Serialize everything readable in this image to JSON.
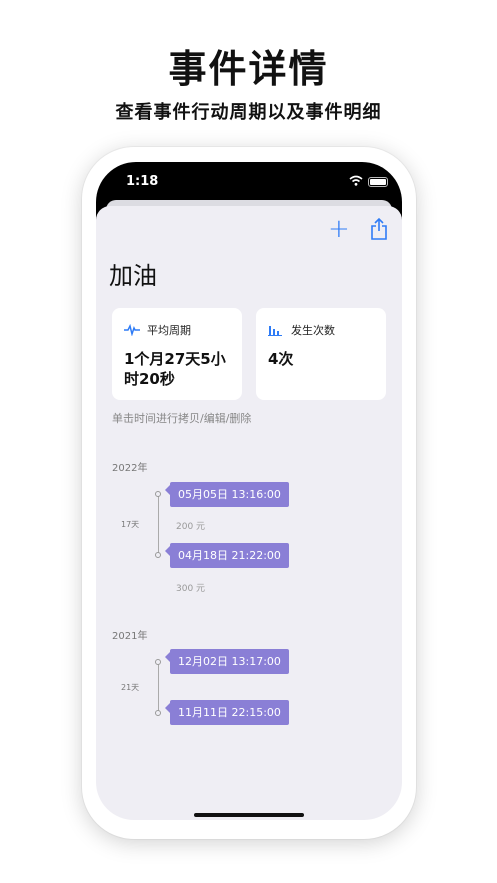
{
  "promo": {
    "title": "事件详情",
    "subtitle": "查看事件行动周期以及事件明细"
  },
  "status_bar": {
    "time": "1:18"
  },
  "nav": {
    "add_icon": "plus-icon",
    "share_icon": "share-icon"
  },
  "event_name": "加油",
  "stats": [
    {
      "icon": "waveform-icon",
      "label": "平均周期",
      "value": "1个月27天5小时20秒"
    },
    {
      "icon": "bar-chart-icon",
      "label": "发生次数",
      "value": "4次"
    }
  ],
  "hint": "单击时间进行拷贝/编辑/删除",
  "timeline": [
    {
      "year": "2022年",
      "interval": "17天",
      "records": [
        {
          "datetime": "05月05日 13:16:00",
          "amount": "200 元"
        },
        {
          "datetime": "04月18日 21:22:00",
          "amount": "300 元"
        }
      ]
    },
    {
      "year": "2021年",
      "interval": "21天",
      "records": [
        {
          "datetime": "12月02日 13:17:00",
          "amount": ""
        },
        {
          "datetime": "11月11日 22:15:00",
          "amount": ""
        }
      ]
    }
  ],
  "colors": {
    "accent": "#2f7cf6",
    "event_bubble": "#8a7fd6",
    "background": "#efeef4"
  }
}
